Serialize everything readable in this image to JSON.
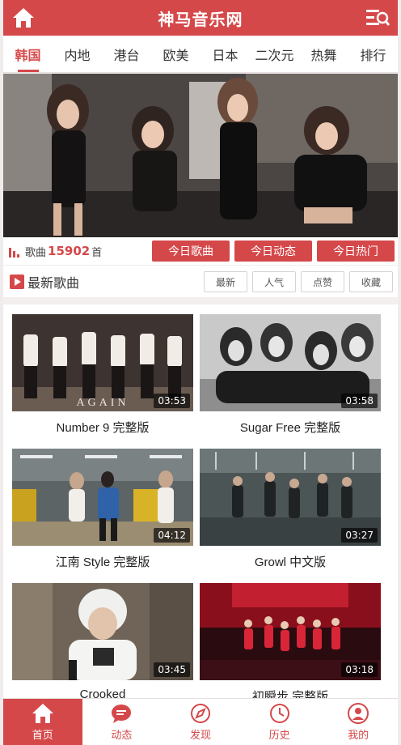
{
  "app": {
    "title": "神马音乐网"
  },
  "tabs": [
    {
      "label": "韩国",
      "active": true
    },
    {
      "label": "内地"
    },
    {
      "label": "港台"
    },
    {
      "label": "欧美"
    },
    {
      "label": "日本"
    },
    {
      "label": "二次元"
    },
    {
      "label": "热舞"
    },
    {
      "label": "排行"
    }
  ],
  "stats": {
    "prefix": "歌曲",
    "count": "15902",
    "suffix": "首"
  },
  "today_buttons": [
    "今日歌曲",
    "今日动态",
    "今日热门"
  ],
  "section": {
    "title": "最新歌曲",
    "sorts": [
      "最新",
      "人气",
      "点赞",
      "收藏"
    ]
  },
  "videos": [
    {
      "title": "Number 9 完整版",
      "duration": "03:53",
      "thumb_label": "AGAIN"
    },
    {
      "title": "Sugar Free 完整版",
      "duration": "03:58"
    },
    {
      "title": "江南 Style 完整版",
      "duration": "04:12"
    },
    {
      "title": "Growl 中文版",
      "duration": "03:27"
    },
    {
      "title": "Crooked",
      "duration": "03:45"
    },
    {
      "title": "初瞬步 完整版",
      "duration": "03:18"
    }
  ],
  "bottom_nav": [
    {
      "label": "首页",
      "icon": "home-icon",
      "active": true
    },
    {
      "label": "动态",
      "icon": "chat-icon"
    },
    {
      "label": "发现",
      "icon": "compass-icon"
    },
    {
      "label": "历史",
      "icon": "clock-icon"
    },
    {
      "label": "我的",
      "icon": "user-icon"
    }
  ],
  "colors": {
    "accent": "#d5484a",
    "background": "#f3efef"
  }
}
